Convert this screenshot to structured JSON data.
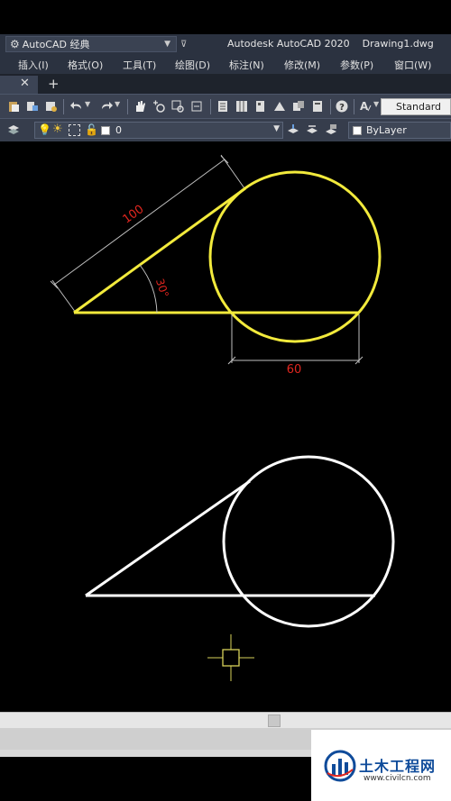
{
  "titlebar": {
    "workspace": "AutoCAD 经典",
    "app_title": "Autodesk AutoCAD 2020",
    "document": "Drawing1.dwg"
  },
  "menu": {
    "items": [
      "插入(I)",
      "格式(O)",
      "工具(T)",
      "绘图(D)",
      "标注(N)",
      "修改(M)",
      "参数(P)",
      "窗口(W)"
    ]
  },
  "toolbar": {
    "text_style": "Standard",
    "layer_name": "0",
    "color": "ByLayer"
  },
  "drawing": {
    "dim_length": "100",
    "dim_angle": "30°",
    "dim_width": "60",
    "colors": {
      "selected": "#f2ea3c",
      "normal": "#ffffff",
      "dimension": "#bfbfbf",
      "dim_text": "#e0261f",
      "cursor": "#d8d25a"
    }
  },
  "watermark": {
    "title": "土木工程网",
    "url": "www.civilcn.com"
  }
}
